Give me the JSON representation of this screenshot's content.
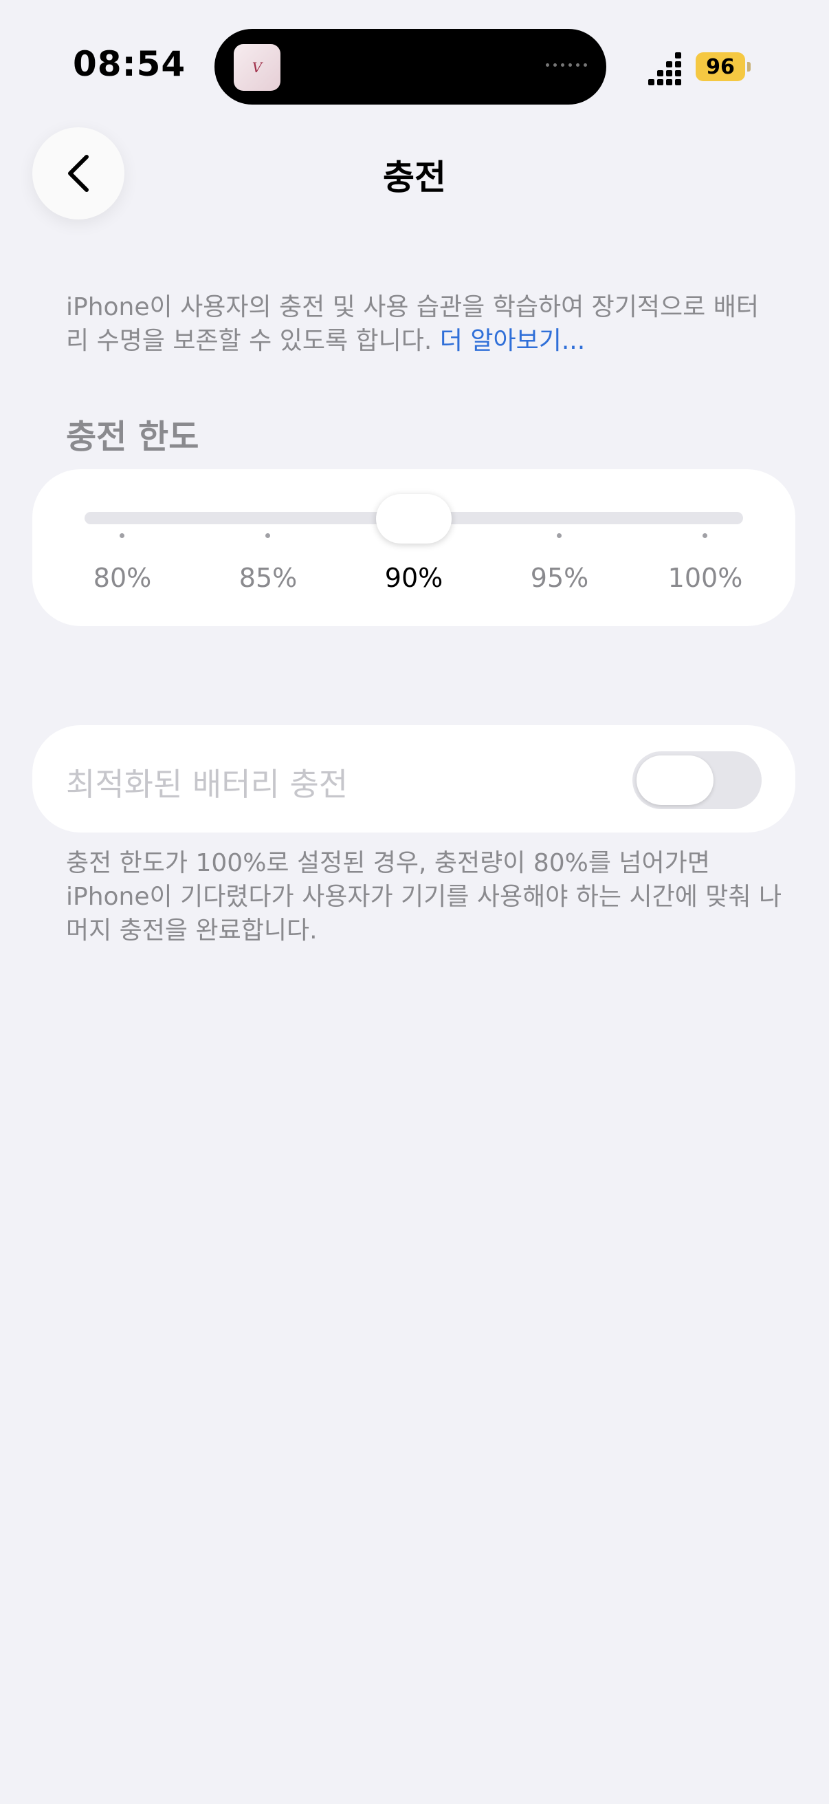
{
  "status_bar": {
    "time": "08:54",
    "island_app_icon": "app-icon",
    "battery_level": "96",
    "battery_color": "#f5c842"
  },
  "nav": {
    "back_icon": "chevron-left-icon",
    "title": "충전"
  },
  "description": {
    "text": "iPhone이 사용자의 충전 및 사용 습관을 학습하여 장기적으로 배터리 수명을 보존할 수 있도록 합니다. ",
    "link": "더 알아보기..."
  },
  "charge_limit": {
    "label": "충전 한도",
    "options": [
      "80%",
      "85%",
      "90%",
      "95%",
      "100%"
    ],
    "selected": "90%"
  },
  "optimized_charging": {
    "label": "최적화된 배터리 충전",
    "enabled": false
  },
  "footer_text": "충전 한도가 100%로 설정된 경우, 충전량이 80%를 넘어가면 iPhone이 기다렸다가 사용자가 기기를 사용해야 하는 시간에 맞춰 나머지 충전을 완료합니다.",
  "colors": {
    "background": "#f2f2f7",
    "link": "#2f6fd8",
    "secondary_text": "#8a8a8e"
  }
}
